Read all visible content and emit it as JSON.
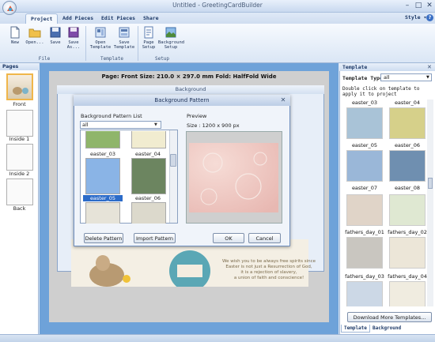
{
  "window": {
    "title": "Untitled - GreetingCardBuilder",
    "controls": [
      "–",
      "□",
      "✕"
    ]
  },
  "ribbon": {
    "tabs": [
      {
        "label": "Project",
        "active": true
      },
      {
        "label": "Add Pieces",
        "active": false
      },
      {
        "label": "Edit Pieces",
        "active": false
      },
      {
        "label": "Share",
        "active": false
      }
    ],
    "style_label": "Style ▾",
    "help": "?",
    "buttons": {
      "new": "New",
      "open": "Open...",
      "save": "Save",
      "save_as": "Save As...",
      "open_template": "Open Template",
      "save_template": "Save Template",
      "page_setup": "Page Setup",
      "background_setup": "Background Setup"
    },
    "groups": {
      "file": "File",
      "template": "Template",
      "setup": "Setup"
    }
  },
  "pages_pane": {
    "header": "Pages",
    "items": [
      {
        "label": "Front"
      },
      {
        "label": "Inside 1"
      },
      {
        "label": "Inside 2"
      },
      {
        "label": "Back"
      }
    ]
  },
  "canvas": {
    "page_info": "Page: Front   Size: 210.0 × 297.0 mm   Fold: HalfFold Wide",
    "card_text": [
      "We wish you to be always free spirits since",
      "Easter is not just a Resurrection of God,",
      "it is a rejection of slavery,",
      "a union of faith and conscience!"
    ]
  },
  "background_dialog": {
    "title": "Background"
  },
  "pattern_dialog": {
    "title": "Background Pattern",
    "close": "✕",
    "list_label": "Background Pattern List",
    "filter_value": "all",
    "patterns": [
      {
        "label": "easter_03",
        "color": "#8fb56a",
        "selected": false
      },
      {
        "label": "easter_04",
        "color": "#f1ecd0",
        "selected": false
      },
      {
        "label": "easter_05",
        "color": "#8ab4e6",
        "selected": true
      },
      {
        "label": "easter_06",
        "color": "#6c8560",
        "selected": false
      }
    ],
    "preview_label": "Preview",
    "size_label": "Size : 1200 x 900 px",
    "buttons": {
      "delete": "Delete Pattern",
      "import": "Import Pattern",
      "ok": "OK",
      "cancel": "Cancel"
    }
  },
  "template_pane": {
    "header": "Template",
    "close": "✕",
    "type_label": "Template Type",
    "type_value": "all",
    "hint": "Double click on template to apply it to project",
    "items": [
      {
        "label": "easter_03",
        "color": "#a9c3d7"
      },
      {
        "label": "easter_04",
        "color": "#d6d08a"
      },
      {
        "label": "easter_05",
        "color": "#e7c8a0"
      },
      {
        "label": "easter_06",
        "color": "#d9d1c2"
      },
      {
        "label": "easter_07",
        "color": "#9ab7d8"
      },
      {
        "label": "easter_08",
        "color": "#6f8fb0"
      },
      {
        "label": "fathers_day_01",
        "color": "#e0d4c8"
      },
      {
        "label": "fathers_day_02",
        "color": "#dfe8d2"
      },
      {
        "label": "fathers_day_03",
        "color": "#c9c6c0"
      },
      {
        "label": "fathers_day_04",
        "color": "#ece6d8"
      },
      {
        "label": "",
        "color": "#ccd8e6"
      },
      {
        "label": "",
        "color": "#f0ece0"
      }
    ],
    "download_label": "Download More Templates...",
    "bottom_tabs": [
      {
        "label": "Template",
        "active": true
      },
      {
        "label": "Background",
        "active": false
      }
    ]
  }
}
